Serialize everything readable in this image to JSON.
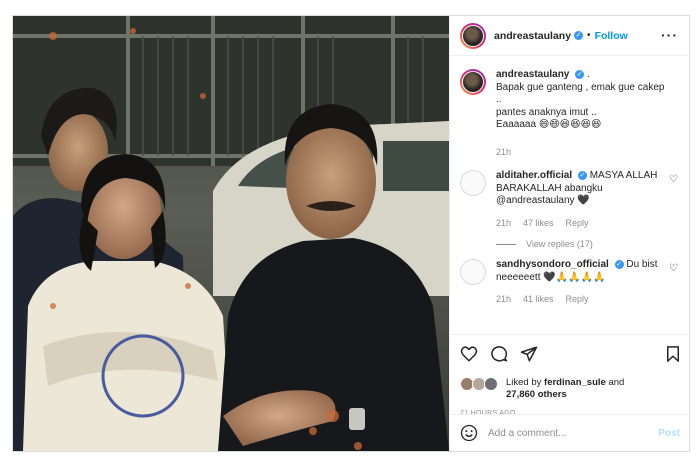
{
  "post": {
    "username": "andreastaulany",
    "follow_label": "Follow",
    "dot": "•",
    "more": "···",
    "caption": {
      "username": "andreastaulany",
      "text_suffix": ".",
      "lines": [
        "Bapak gue ganteng , emak gue cakep ..",
        "pantes anaknya imut ..",
        "Eaaaaaa 😄😄😆😆😆😆"
      ],
      "time": "21h"
    }
  },
  "comments": [
    {
      "username": "alditaher.official",
      "text": "MASYA ALLAH BARAKALLAH abangku @andreastaulany 🖤",
      "time": "21h",
      "likes": "47 likes",
      "reply": "Reply",
      "view_replies": "View replies (17)"
    },
    {
      "username": "sandhysondoro_official",
      "text": "Du bist neeeeeett 🖤🙏🙏🙏🙏",
      "time": "21h",
      "likes": "41 likes",
      "reply": "Reply"
    }
  ],
  "likes": {
    "prefix": "Liked by",
    "user": "ferdinan_sule",
    "suffix": "and",
    "others": "27,860 others"
  },
  "time_ago": "21 HOURS AGO",
  "comment_box": {
    "placeholder": "Add a comment...",
    "post_label": "Post"
  },
  "colors": {
    "accent": "#0095f6",
    "verified": "#3897f0",
    "muted": "#8e8e8e",
    "post_disabled": "#b2dffc"
  },
  "icons": [
    "heart-icon",
    "comment-icon",
    "share-icon",
    "save-icon",
    "emoji-icon",
    "more-icon",
    "verified-icon"
  ]
}
